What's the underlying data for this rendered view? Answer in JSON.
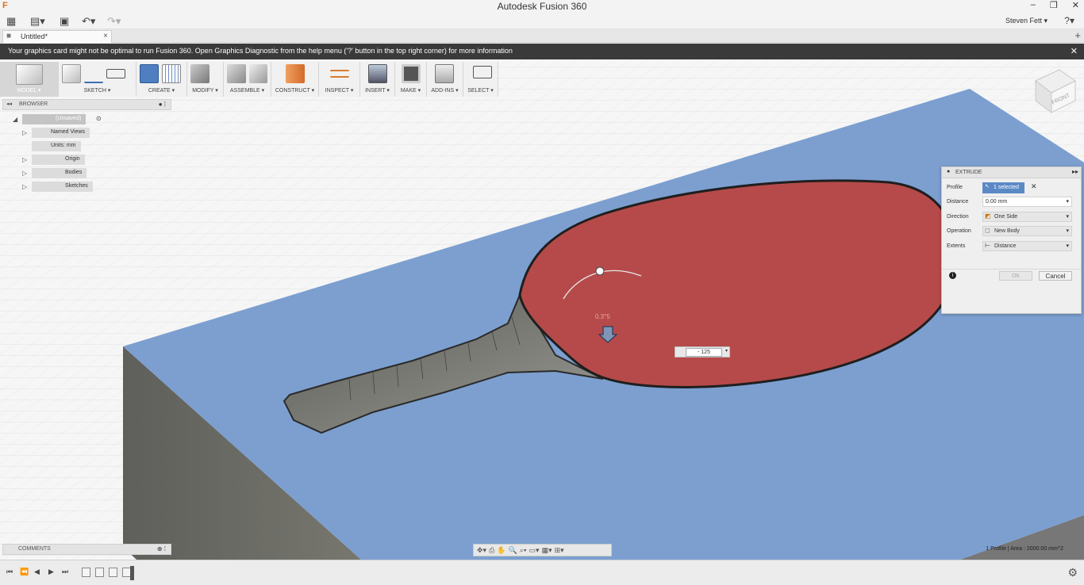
{
  "window": {
    "title": "Autodesk Fusion 360",
    "app_icon": "F",
    "minimize": "–",
    "maximize": "❐",
    "close": "✕"
  },
  "quick_access": {
    "user": "Steven Fett ▾",
    "help": "?▾"
  },
  "doc_tab": {
    "label": "Untitled*",
    "close": "×",
    "new_tab": "+"
  },
  "banner": {
    "message": "Your graphics card might not be optimal to run Fusion 360. Open Graphics Diagnostic from the help menu ('?' button in the top right corner) for more information",
    "close": "✕"
  },
  "toolbar": {
    "groups": [
      {
        "label": "MODEL ▾"
      },
      {
        "label": "SKETCH ▾"
      },
      {
        "label": "CREATE ▾"
      },
      {
        "label": "MODIFY ▾"
      },
      {
        "label": "ASSEMBLE ▾"
      },
      {
        "label": "CONSTRUCT ▾"
      },
      {
        "label": "INSPECT ▾"
      },
      {
        "label": "INSERT ▾"
      },
      {
        "label": "MAKE ▾"
      },
      {
        "label": "ADD-INS ▾"
      },
      {
        "label": "SELECT ▾"
      }
    ]
  },
  "browser": {
    "title": "BROWSER",
    "root": "(Unsaved)",
    "items": [
      {
        "label": "Named Views"
      },
      {
        "label": "Units: mm"
      },
      {
        "label": "Origin"
      },
      {
        "label": "Bodies"
      },
      {
        "label": "Sketches"
      }
    ]
  },
  "viewcube": {
    "face": "FRONT"
  },
  "extrude": {
    "title": "EXTRUDE",
    "rows": [
      {
        "key": "Profile",
        "value": "1 selected"
      },
      {
        "key": "Distance",
        "value": "0.00 mm"
      },
      {
        "key": "Direction",
        "value": "One Side"
      },
      {
        "key": "Operation",
        "value": "New Body"
      },
      {
        "key": "Extents",
        "value": "Distance"
      }
    ],
    "ok": "OK",
    "cancel": "Cancel"
  },
  "canvas": {
    "angle_readout": "0.3°5",
    "distance_input": "- 125"
  },
  "comments": {
    "title": "COMMENTS"
  },
  "status": {
    "text": "1 Profile | Area : 2000.00 mm^2"
  },
  "colors": {
    "blue_face": "#7c9fd0",
    "red_face": "#b64a4a",
    "side_face": "#6a6a66",
    "grid": "#dcdcdc",
    "banner": "#3a3a3a",
    "selection": "#5b89c6"
  }
}
